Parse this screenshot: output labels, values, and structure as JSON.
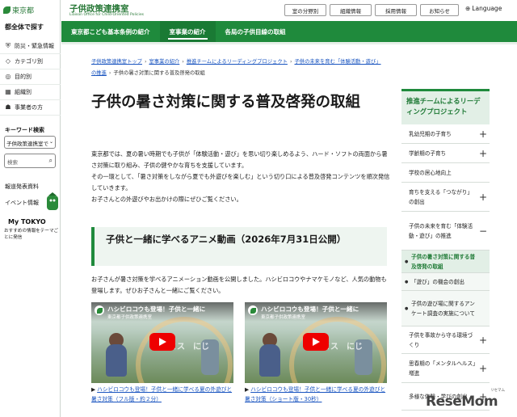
{
  "sidebar": {
    "gov_name": "東京都",
    "search_title": "都全体で探す",
    "items": [
      {
        "icon": "shield-icon",
        "label": "防災・緊急情報"
      },
      {
        "icon": "tag-icon",
        "label": "カテゴリ別"
      },
      {
        "icon": "target-icon",
        "label": "目的別"
      },
      {
        "icon": "building-icon",
        "label": "組織別"
      },
      {
        "icon": "people-icon",
        "label": "事業者の方"
      }
    ],
    "keyword_title": "キーワード検索",
    "select_value": "子供政策連携室で",
    "search_placeholder": "検索",
    "link_press": "報道発表資料",
    "link_events": "イベント情報",
    "mytokyo_label": "My TOKYO",
    "mytokyo_desc": "おすすめの情報をテーマごとに発信"
  },
  "header": {
    "office_title": "子供政策連携室",
    "office_subtitle": "Liaison Office for Child-Oriented Policies",
    "buttons": [
      "室の分野別",
      "組織情報",
      "採用情報",
      "お知らせ"
    ],
    "language": "Language"
  },
  "nav": {
    "items": [
      "東京都こども基本条例の紹介",
      "室事業の紹介",
      "各局の子供目線の取組"
    ],
    "active_index": 1
  },
  "breadcrumb": [
    "子供政策連携室トップ",
    "室事業の紹介",
    "推進チームによるリーディングプロジェクト",
    "子供の未来を育む「体験活動・遊び」の推進",
    "子供の暑さ対策に関する普及啓発の取組"
  ],
  "main": {
    "title": "子供の暑さ対策に関する普及啓発の取組",
    "intro": [
      "東京都では、夏の暑い時期でも子供が「体験活動・遊び」を思い切り楽しめるよう、ハード・ソフトの両面から暑さ対策に取り組み、子供の健やかな育ちを支援しています。",
      "その一環として、「暑さ対策をしながら夏でも外遊びを楽しむ」という切り口による普及啓発コンテンツを順次発信していきます。",
      "お子さんとの外遊びやお出かけの際にぜひご覧ください。"
    ],
    "section_title": "子供と一緒に学べるアニメ動画（2026年7月31日公開）",
    "video_desc": "お子さんが暑さ対策を学べるアニメーション動画を公開しました。ハシビロコウやナマケモノなど、人気の動物も登場します。ぜひお子さんと一緒にご覧ください。",
    "videos": [
      {
        "overlay_title": "ハシビロコウも登場！子供と一緒に",
        "channel": "東京都子供政策連携室",
        "watermark": "ミス　にじ",
        "caption": "ハシビロコウも登場！子供と一緒に学べる夏の外遊びと暑さ対策（フル版・約２分）"
      },
      {
        "overlay_title": "ハシビロコウも登場！子供と一緒に",
        "channel": "東京都子供政策連携室",
        "watermark": "ミス　にじ",
        "caption": "ハシビロコウも登場！子供と一緒に学べる夏の外遊びと暑さ対策（ショート版・30秒）"
      }
    ]
  },
  "right_sidebar": {
    "title": "推進チームによるリーディングプロジェクト",
    "items": [
      {
        "label": "乳幼児期の子育ち",
        "ctrl": "+"
      },
      {
        "label": "学齢期の子育ち",
        "ctrl": "+"
      },
      {
        "label": "学校の居心地向上",
        "ctrl": ""
      },
      {
        "label": "育ちを支える「つながり」の創出",
        "ctrl": "+"
      },
      {
        "label": "子供の未来を育む「体験活動・遊び」の推進",
        "ctrl": "−"
      },
      {
        "label": "子供の暑さ対策に関する普及啓発の取組",
        "ctrl": ""
      },
      {
        "label": "「遊び」の機会の創出",
        "ctrl": ""
      },
      {
        "label": "子供の遊び場に関するアンケート調査の実施について",
        "ctrl": ""
      },
      {
        "label": "子供を事故から守る環境づくり",
        "ctrl": "+"
      },
      {
        "label": "思春期の「メンタルヘルス」増進",
        "ctrl": "+"
      },
      {
        "label": "多様な体験・学びの創出",
        "ctrl": "+"
      }
    ]
  },
  "watermark": {
    "brand": "ReseMom",
    "small": "リセマム"
  },
  "colors": {
    "brand_green": "#1f8a3c",
    "link_blue": "#1a55c0",
    "youtube_red": "#ee0000"
  }
}
